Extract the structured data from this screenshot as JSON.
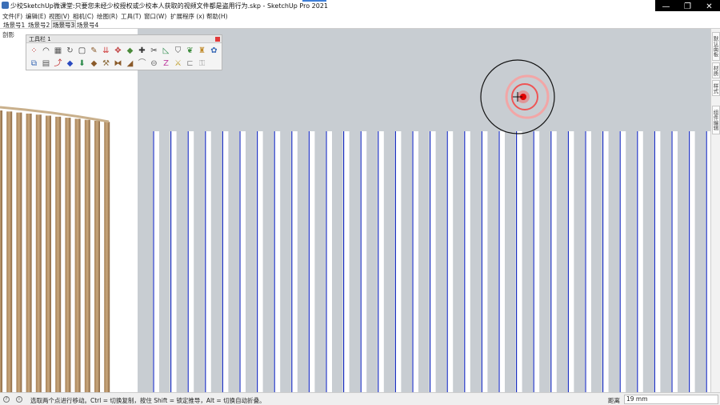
{
  "window": {
    "title": "少校SketchUp微课堂:只要您未经少校授权或少校本人获取的视频文件都是盗用行为.skp - SketchUp Pro 2021",
    "minimize": "—",
    "maximize": "❐",
    "close": "✕"
  },
  "menu": [
    {
      "label": "文件(F)"
    },
    {
      "label": "编辑(E)"
    },
    {
      "label": "视图(V)"
    },
    {
      "label": "相机(C)"
    },
    {
      "label": "绘图(R)"
    },
    {
      "label": "工具(T)"
    },
    {
      "label": "窗口(W)"
    },
    {
      "label": "扩展程序 (x)"
    },
    {
      "label": "帮助(H)"
    }
  ],
  "scenes": [
    {
      "label": "场景号1"
    },
    {
      "label": "场景号2"
    },
    {
      "label": "场景号3"
    },
    {
      "label": "场景号4"
    }
  ],
  "active_scene": "场景号3",
  "left_panel": {
    "label": "剖影"
  },
  "toolbar": {
    "title": "工具栏 1",
    "tools": [
      {
        "name": "sandbox-contour-icon",
        "glyph": "⁘",
        "color": "#c23b3b"
      },
      {
        "name": "arc-icon",
        "glyph": "◠",
        "color": "#333"
      },
      {
        "name": "grid-icon",
        "glyph": "▦",
        "color": "#555"
      },
      {
        "name": "rotate-icon",
        "glyph": "↻",
        "color": "#555"
      },
      {
        "name": "rectangle-icon",
        "glyph": "▢",
        "color": "#333"
      },
      {
        "name": "pencil-icon",
        "glyph": "✎",
        "color": "#8a5a2a"
      },
      {
        "name": "push-pull-icon",
        "glyph": "⇊",
        "color": "#d04040"
      },
      {
        "name": "move-icon",
        "glyph": "✥",
        "color": "#c04040"
      },
      {
        "name": "box-icon",
        "glyph": "◆",
        "color": "#4a8a3a"
      },
      {
        "name": "line-plus-icon",
        "glyph": "✚",
        "color": "#333"
      },
      {
        "name": "knife-icon",
        "glyph": "✂",
        "color": "#333"
      },
      {
        "name": "tape-icon",
        "glyph": "◺",
        "color": "#2a8a4a"
      },
      {
        "name": "shield-icon",
        "glyph": "⛉",
        "color": "#555"
      },
      {
        "name": "leaf-icon",
        "glyph": "❦",
        "color": "#3a8a3a"
      },
      {
        "name": "paint-icon",
        "glyph": "♜",
        "color": "#c08a2a"
      },
      {
        "name": "extension-icon",
        "glyph": "✿",
        "color": "#3a6ab6"
      },
      {
        "name": "layer-icon",
        "glyph": "⧉",
        "color": "#3a6ab6"
      },
      {
        "name": "stack-icon",
        "glyph": "▤",
        "color": "#555"
      },
      {
        "name": "curve-icon",
        "glyph": "⤴",
        "color": "#c03030"
      },
      {
        "name": "shape-blue-icon",
        "glyph": "◆",
        "color": "#2a4ac0"
      },
      {
        "name": "drop-icon",
        "glyph": "⬇",
        "color": "#2a8a4a"
      },
      {
        "name": "wood-icon",
        "glyph": "◆",
        "color": "#8a5a2a"
      },
      {
        "name": "brush-icon",
        "glyph": "⚒",
        "color": "#8a6a3a"
      },
      {
        "name": "ribbon-icon",
        "glyph": "⧓",
        "color": "#8a5a2a"
      },
      {
        "name": "bend-icon",
        "glyph": "◢",
        "color": "#8a5a2a"
      },
      {
        "name": "pipe-icon",
        "glyph": "⌒",
        "color": "#777"
      },
      {
        "name": "cut-icon",
        "glyph": "⊖",
        "color": "#666"
      },
      {
        "name": "z-icon",
        "glyph": "Z",
        "color": "#c040a0"
      },
      {
        "name": "hammer-icon",
        "glyph": "⚔",
        "color": "#c0a030"
      },
      {
        "name": "folder-icon",
        "glyph": "⊏",
        "color": "#888"
      },
      {
        "name": "lock-icon",
        "glyph": "⚿",
        "color": "#aaa"
      }
    ]
  },
  "tray_tabs": [
    {
      "label": "默认面板"
    },
    {
      "label": "材质"
    },
    {
      "label": "样式"
    },
    {
      "label": "组件编辑"
    }
  ],
  "scene": {
    "bar_color": "#ffffff",
    "edge_color": "#1b2fbf",
    "background": "#c8cdd2"
  },
  "status": {
    "message": "选取两个点进行移动。Ctrl = 切换复制，按住 Shift = 锁定推导，Alt = 切换自动折叠。",
    "measure_label": "距离",
    "measure_value": "19 mm"
  }
}
